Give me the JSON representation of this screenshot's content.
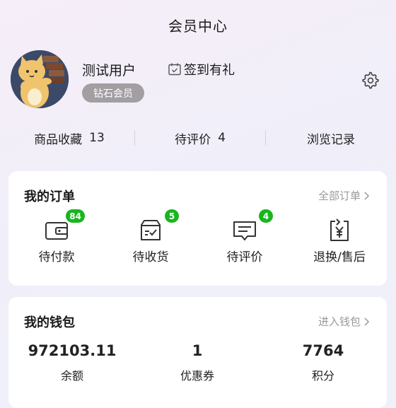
{
  "header": {
    "title": "会员中心"
  },
  "profile": {
    "username": "测试用户",
    "checkin_label": "签到有礼",
    "vip_label": "钻石会员"
  },
  "stats": [
    {
      "label": "商品收藏",
      "count": "13"
    },
    {
      "label": "待评价",
      "count": "4"
    },
    {
      "label": "浏览记录",
      "count": ""
    }
  ],
  "orders": {
    "title": "我的订单",
    "link_label": "全部订单",
    "items": [
      {
        "label": "待付款",
        "badge": "84",
        "icon": "wallet-icon"
      },
      {
        "label": "待收货",
        "badge": "5",
        "icon": "package-icon"
      },
      {
        "label": "待评价",
        "badge": "4",
        "icon": "comment-icon"
      },
      {
        "label": "退换/售后",
        "badge": "",
        "icon": "refund-icon"
      }
    ]
  },
  "wallet": {
    "title": "我的钱包",
    "link_label": "进入钱包",
    "items": [
      {
        "value": "972103.11",
        "label": "余额"
      },
      {
        "value": "1",
        "label": "优惠券"
      },
      {
        "value": "7764",
        "label": "积分"
      }
    ]
  },
  "colors": {
    "badge_green": "#19b51f",
    "vip_badge_bg": "#a29ea2",
    "link_gray": "#9a9a9a"
  }
}
